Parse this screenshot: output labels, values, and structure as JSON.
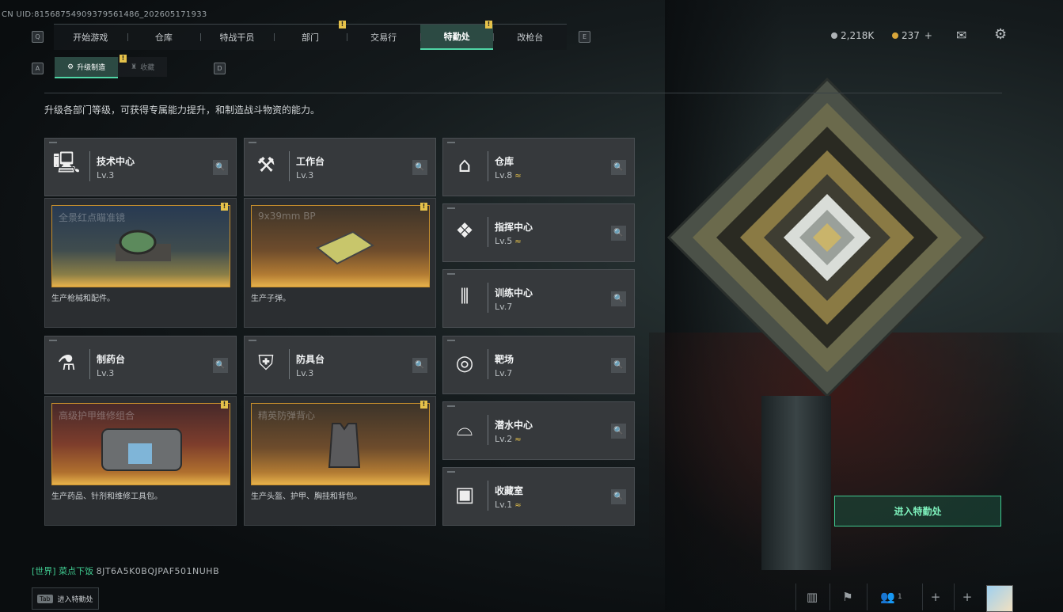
{
  "uid": "CN UID:8156875490937956148​6_202605171933",
  "nav": {
    "left_key": "Q",
    "right_key": "E",
    "tabs": [
      {
        "label": "开始游戏"
      },
      {
        "label": "仓库"
      },
      {
        "label": "特战干员"
      },
      {
        "label": "部门"
      },
      {
        "label": "交易行"
      },
      {
        "label": "特勤处"
      },
      {
        "label": "改枪台"
      }
    ]
  },
  "subnav": {
    "left_key": "A",
    "right_key": "D",
    "tabs": [
      {
        "label": "升级制造"
      },
      {
        "label": "收藏"
      }
    ]
  },
  "header": {
    "currency_silver": "2,218K",
    "currency_gold": "237",
    "plus": "+"
  },
  "description": "升级各部门等级，可获得专属能力提升，和制造战斗物资的能力。",
  "departments": [
    {
      "name": "技术中心",
      "level": "Lv.3",
      "icon": "monitor-icon",
      "glyph": "🖳",
      "upgrade": false
    },
    {
      "name": "工作台",
      "level": "Lv.3",
      "icon": "tools-icon",
      "glyph": "⚒",
      "upgrade": false
    },
    {
      "name": "仓库",
      "level": "Lv.8",
      "icon": "warehouse-icon",
      "glyph": "⌂",
      "upgrade": true
    },
    {
      "name": "指挥中心",
      "level": "Lv.5",
      "icon": "command-icon",
      "glyph": "❖",
      "upgrade": true
    },
    {
      "name": "训练中心",
      "level": "Lv.7",
      "icon": "dumbbell-icon",
      "glyph": "⫴",
      "upgrade": false
    },
    {
      "name": "制药台",
      "level": "Lv.3",
      "icon": "flask-icon",
      "glyph": "⚗",
      "upgrade": false
    },
    {
      "name": "防具台",
      "level": "Lv.3",
      "icon": "armor-icon",
      "glyph": "⛨",
      "upgrade": false
    },
    {
      "name": "靶场",
      "level": "Lv.7",
      "icon": "target-icon",
      "glyph": "◎",
      "upgrade": false
    },
    {
      "name": "潜水中心",
      "level": "Lv.2",
      "icon": "diving-mask-icon",
      "glyph": "⌓",
      "upgrade": true
    },
    {
      "name": "收藏室",
      "level": "Lv.1",
      "icon": "collection-icon",
      "glyph": "▣",
      "upgrade": true
    }
  ],
  "productions": [
    {
      "item": "全景红点瞄准镜",
      "desc": "生产枪械和配件。"
    },
    {
      "item": "9x39mm BP",
      "desc": "生产子弹。"
    },
    {
      "item": "高级护甲维修组合",
      "desc": "生产药品、针剂和维修工具包。"
    },
    {
      "item": "精英防弹背心",
      "desc": "生产头盔、护甲、胸挂和背包。"
    }
  ],
  "upgrade_glyph": "≈",
  "badge_glyph": "!",
  "search_glyph": "🔍",
  "enter_button": "进入特勤处",
  "chat": {
    "channel": "[世界]",
    "text": " 菜点下饭 ",
    "code": "8JT6A5K0BQJPAF501NUHB"
  },
  "tab_hint": {
    "key": "Tab",
    "label": "进入特勤处"
  },
  "bottom": {
    "friends_count": "1"
  },
  "colors": {
    "accent": "#4fd6a6",
    "badge": "#e6c24a"
  }
}
